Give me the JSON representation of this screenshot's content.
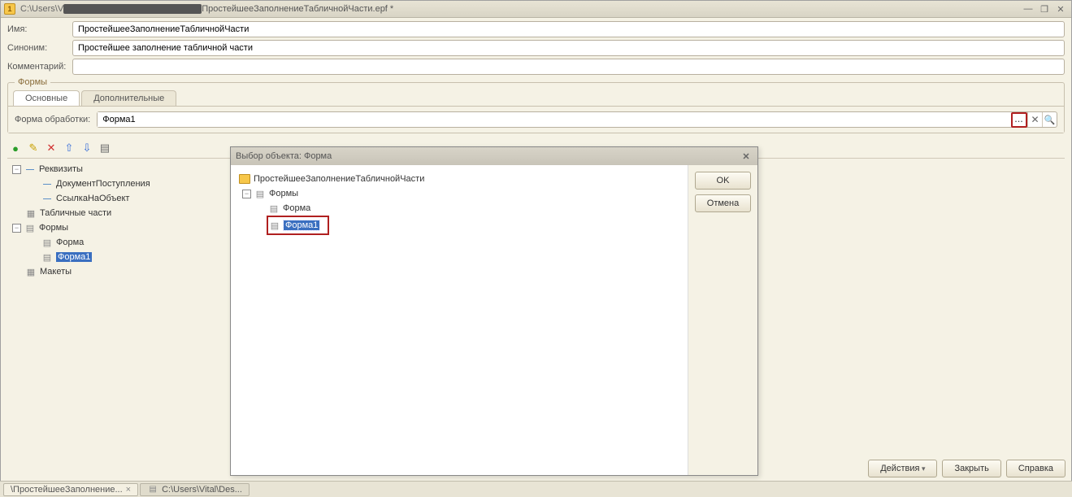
{
  "window": {
    "path_prefix": "C:\\Users\\V",
    "file": "ПростейшееЗаполнениеТабличнойЧасти.epf *"
  },
  "labels": {
    "name": "Имя:",
    "synonym": "Синоним:",
    "comment": "Комментарий:",
    "forms_group": "Формы",
    "tab_main": "Основные",
    "tab_extra": "Дополнительные",
    "form_processing": "Форма обработки:"
  },
  "fields": {
    "name": "ПростейшееЗаполнениеТабличнойЧасти",
    "synonym": "Простейшее заполнение табличной части",
    "comment": "",
    "processing_form": "Форма1"
  },
  "tree": {
    "root_attrs": "Реквизиты",
    "attr1": "ДокументПоступления",
    "attr2": "СсылкаНаОбъект",
    "tabparts": "Табличные части",
    "forms": "Формы",
    "form": "Форма",
    "form1": "Форма1",
    "layouts": "Макеты"
  },
  "dialog": {
    "title": "Выбор объекта: Форма",
    "root": "ПростейшееЗаполнениеТабличнойЧасти",
    "forms": "Формы",
    "form": "Форма",
    "form1": "Форма1",
    "ok": "OK",
    "cancel": "Отмена"
  },
  "buttons": {
    "actions": "Действия",
    "close": "Закрыть",
    "help": "Справка"
  },
  "status": {
    "tab1": "\\ПростейшееЗаполнение...",
    "tab2": "C:\\Users\\Vital\\Des..."
  },
  "icons": {
    "ellipsis": "..."
  }
}
